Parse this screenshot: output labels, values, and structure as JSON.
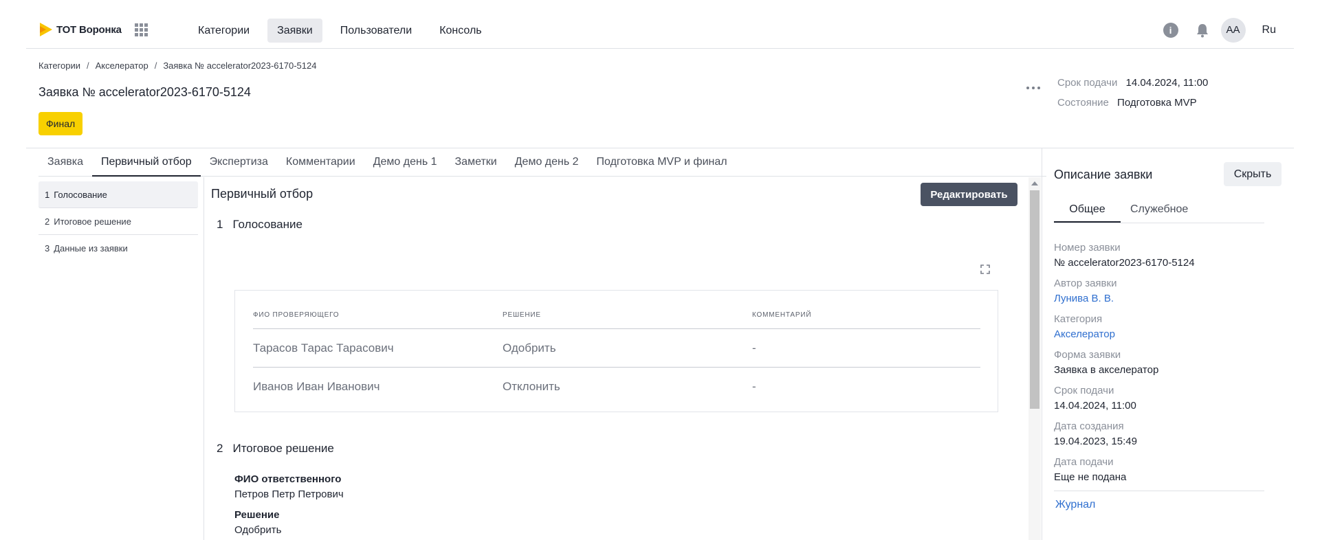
{
  "app": {
    "logo_text": "ТОТ Воронка"
  },
  "nav": {
    "items": [
      {
        "label": "Категории"
      },
      {
        "label": "Заявки"
      },
      {
        "label": "Пользователи"
      },
      {
        "label": "Консоль"
      }
    ],
    "active_index": 1
  },
  "topright": {
    "avatar": "AA",
    "lang": "Ru",
    "info_glyph": "i"
  },
  "breadcrumb": [
    "Категории",
    "Акселератор",
    "Заявка № accelerator2023-6170-5124"
  ],
  "page": {
    "title": "Заявка № accelerator2023-6170-5124",
    "badge": "Финал",
    "meta": [
      {
        "label": "Срок подачи",
        "value": "14.04.2024, 11:00"
      },
      {
        "label": "Состояние",
        "value": "Подготовка MVP"
      }
    ]
  },
  "tabs": [
    "Заявка",
    "Первичный отбор",
    "Экспертиза",
    "Комментарии",
    "Демо день 1",
    "Заметки",
    "Демо день 2",
    "Подготовка MVP и финал"
  ],
  "active_tab": 1,
  "steps": [
    {
      "n": "1",
      "label": "Голосование"
    },
    {
      "n": "2",
      "label": "Итоговое решение"
    },
    {
      "n": "3",
      "label": "Данные из заявки"
    }
  ],
  "main": {
    "title": "Первичный отбор",
    "edit_label": "Редактировать",
    "section1": {
      "n": "1",
      "title": "Голосование"
    },
    "table": {
      "columns": [
        "ФИО проверяющего",
        "Решение",
        "Комментарий"
      ],
      "rows": [
        [
          "Тарасов Тарас Тарасович",
          "Одобрить",
          "-"
        ],
        [
          "Иванов Иван Иванович",
          "Отклонить",
          "-"
        ]
      ]
    },
    "section2": {
      "n": "2",
      "title": "Итоговое решение"
    },
    "fields": [
      {
        "label": "ФИО ответственного",
        "value": "Петров Петр Петрович"
      },
      {
        "label": "Решение",
        "value": "Одобрить"
      }
    ]
  },
  "right_panel": {
    "title": "Описание заявки",
    "hide_label": "Скрыть",
    "tabs": [
      "Общее",
      "Служебное"
    ],
    "fields": [
      {
        "label": "Номер заявки",
        "value": "№ accelerator2023-6170-5124"
      },
      {
        "label": "Автор заявки",
        "value": "Лунива В. В."
      },
      {
        "label": "Категория",
        "value": "Акселератор"
      },
      {
        "label": "Форма заявки",
        "value": "Заявка в акселератор"
      },
      {
        "label": "Срок подачи",
        "value": "14.04.2024, 11:00"
      },
      {
        "label": "Дата создания",
        "value": "19.04.2023, 15:49"
      },
      {
        "label": "Дата подачи",
        "value": "Еще не подана"
      }
    ],
    "journal_label": "Журнал"
  },
  "colors": {
    "accent": "#f8d000",
    "link": "#2f6fcf",
    "button_dark": "#4a5262"
  }
}
